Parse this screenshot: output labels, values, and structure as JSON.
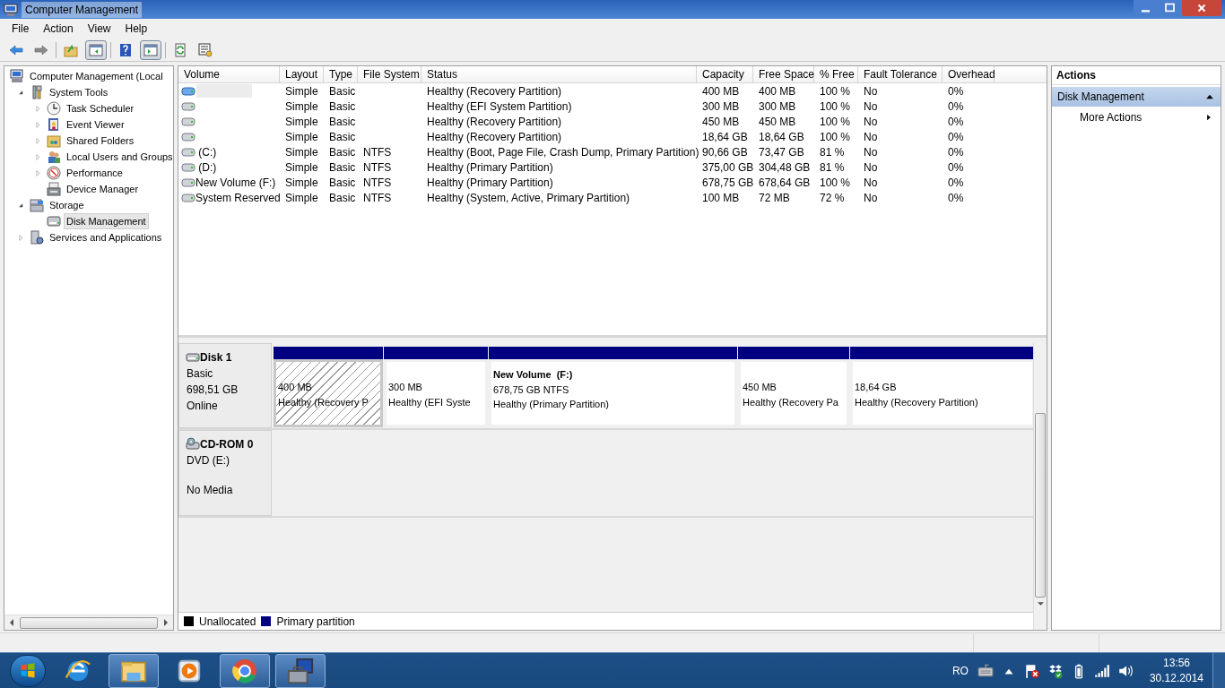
{
  "window": {
    "title": "Computer Management"
  },
  "menu": [
    "File",
    "Action",
    "View",
    "Help"
  ],
  "toolbar": [
    {
      "kind": "back",
      "pressed": false
    },
    {
      "kind": "forward",
      "pressed": false
    },
    {
      "kind": "up",
      "pressed": false
    },
    {
      "kind": "tree",
      "pressed": true
    },
    {
      "kind": "help",
      "pressed": false
    },
    {
      "kind": "pane",
      "pressed": true
    },
    {
      "kind": "refresh",
      "pressed": false
    },
    {
      "kind": "export",
      "pressed": false
    }
  ],
  "tree": [
    {
      "label": "Computer Management (Local",
      "kind": "computer",
      "selected": false,
      "children": [
        {
          "label": "System Tools",
          "kind": "tools",
          "expanded": true,
          "selected": false,
          "children": [
            {
              "label": "Task Scheduler",
              "kind": "clock",
              "expanded": false,
              "selected": false
            },
            {
              "label": "Event Viewer",
              "kind": "log",
              "expanded": false,
              "selected": false
            },
            {
              "label": "Shared Folders",
              "kind": "share",
              "expanded": false,
              "selected": false
            },
            {
              "label": "Local Users and Groups",
              "kind": "users",
              "expanded": false,
              "selected": false
            },
            {
              "label": "Performance",
              "kind": "gauge",
              "expanded": false,
              "selected": false
            },
            {
              "label": "Device Manager",
              "kind": "device",
              "selected": false
            }
          ]
        },
        {
          "label": "Storage",
          "kind": "storage",
          "expanded": true,
          "selected": false,
          "children": [
            {
              "label": "Disk Management",
              "kind": "disk",
              "selected": true
            }
          ]
        },
        {
          "label": "Services and Applications",
          "kind": "services",
          "expanded": false,
          "selected": false
        }
      ]
    }
  ],
  "table": {
    "columns": [
      "Volume",
      "Layout",
      "Type",
      "File System",
      "Status",
      "Capacity",
      "Free Space",
      "% Free",
      "Fault Tolerance",
      "Overhead"
    ],
    "rows": [
      {
        "selected": true,
        "cells": [
          "",
          "Simple",
          "Basic",
          "",
          "Healthy (Recovery Partition)",
          "400 MB",
          "400 MB",
          "100 %",
          "No",
          "0%"
        ]
      },
      {
        "selected": false,
        "cells": [
          "",
          "Simple",
          "Basic",
          "",
          "Healthy (EFI System Partition)",
          "300 MB",
          "300 MB",
          "100 %",
          "No",
          "0%"
        ]
      },
      {
        "selected": false,
        "cells": [
          "",
          "Simple",
          "Basic",
          "",
          "Healthy (Recovery Partition)",
          "450 MB",
          "450 MB",
          "100 %",
          "No",
          "0%"
        ]
      },
      {
        "selected": false,
        "cells": [
          "",
          "Simple",
          "Basic",
          "",
          "Healthy (Recovery Partition)",
          "18,64 GB",
          "18,64 GB",
          "100 %",
          "No",
          "0%"
        ]
      },
      {
        "selected": false,
        "cells": [
          " (C:)",
          "Simple",
          "Basic",
          "NTFS",
          "Healthy (Boot, Page File, Crash Dump, Primary Partition)",
          "90,66 GB",
          "73,47 GB",
          "81 %",
          "No",
          "0%"
        ]
      },
      {
        "selected": false,
        "cells": [
          " (D:)",
          "Simple",
          "Basic",
          "NTFS",
          "Healthy (Primary Partition)",
          "375,00 GB",
          "304,48 GB",
          "81 %",
          "No",
          "0%"
        ]
      },
      {
        "selected": false,
        "cells": [
          "New Volume (F:)",
          "Simple",
          "Basic",
          "NTFS",
          "Healthy (Primary Partition)",
          "678,75 GB",
          "678,64 GB",
          "100 %",
          "No",
          "0%"
        ]
      },
      {
        "selected": false,
        "cells": [
          "System Reserved",
          "Simple",
          "Basic",
          "NTFS",
          "Healthy (System, Active, Primary Partition)",
          "100 MB",
          "72 MB",
          "72 %",
          "No",
          "0%"
        ]
      }
    ]
  },
  "disks": [
    {
      "kind": "disk",
      "name": "Disk 1",
      "lines": [
        "Basic",
        "698,51 GB",
        "Online"
      ],
      "partitions": [
        {
          "kind": "primary",
          "selected": true,
          "lines": [
            "400 MB",
            "Healthy (Recovery P"
          ]
        },
        {
          "kind": "primary",
          "selected": false,
          "lines": [
            "300 MB",
            "Healthy (EFI Syste"
          ]
        },
        {
          "kind": "primary",
          "selected": false,
          "name": "New Volume  (F:)",
          "lines": [
            "678,75 GB NTFS",
            "Healthy (Primary Partition)"
          ]
        },
        {
          "kind": "primary",
          "selected": false,
          "lines": [
            "450 MB",
            "Healthy (Recovery Pa"
          ]
        },
        {
          "kind": "primary",
          "selected": false,
          "lines": [
            "18,64 GB",
            "Healthy (Recovery Partition)"
          ]
        }
      ]
    },
    {
      "kind": "cdrom",
      "name": "CD-ROM 0",
      "lines": [
        "DVD (E:)",
        "No Media"
      ]
    }
  ],
  "legend": [
    {
      "label": "Unallocated",
      "color": "#000000"
    },
    {
      "label": "Primary partition",
      "color": "#000080"
    }
  ],
  "actions": {
    "title": "Actions",
    "sections": [
      {
        "label": "Disk Management",
        "expanded": true,
        "items": [
          "More Actions"
        ]
      }
    ]
  },
  "taskbar": {
    "apps": [
      {
        "kind": "browser",
        "running": false
      },
      {
        "kind": "folder",
        "running": true
      },
      {
        "kind": "player",
        "running": false
      },
      {
        "kind": "chrome",
        "running": true
      },
      {
        "kind": "mmc",
        "running": true
      }
    ],
    "language": "RO",
    "time": "13:56",
    "date": "30.12.2014"
  }
}
